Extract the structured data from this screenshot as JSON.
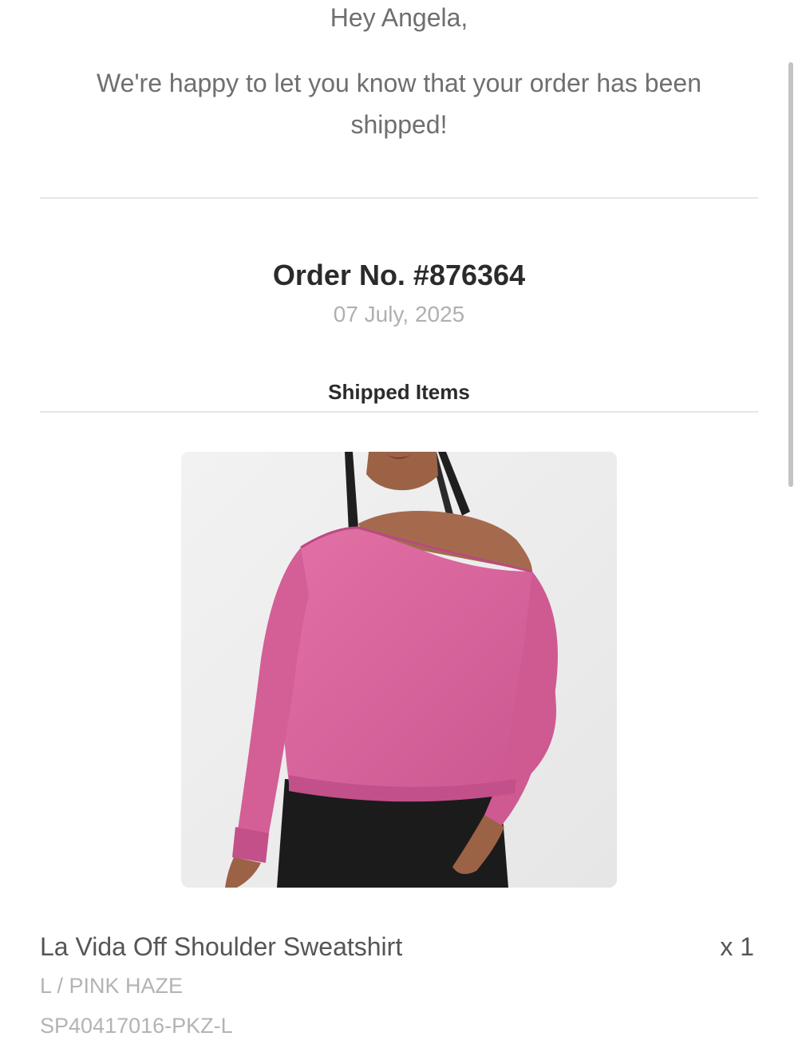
{
  "email": {
    "greeting": "Hey Angela,",
    "message": "We're happy to let you know that your order has been shipped!"
  },
  "order": {
    "number_label": "Order No. #876364",
    "date": "07 July, 2025"
  },
  "shipped_items": {
    "title": "Shipped Items",
    "items": [
      {
        "name": "La Vida Off Shoulder Sweatshirt",
        "quantity": "x 1",
        "variant": "L / PINK HAZE",
        "sku": "SP40417016-PKZ-L",
        "image": "product-photo-pink-off-shoulder-sweatshirt"
      }
    ]
  },
  "colors": {
    "sweatshirt": "#d9639a",
    "background": "#ffffff",
    "divider": "#e6e6e6"
  }
}
